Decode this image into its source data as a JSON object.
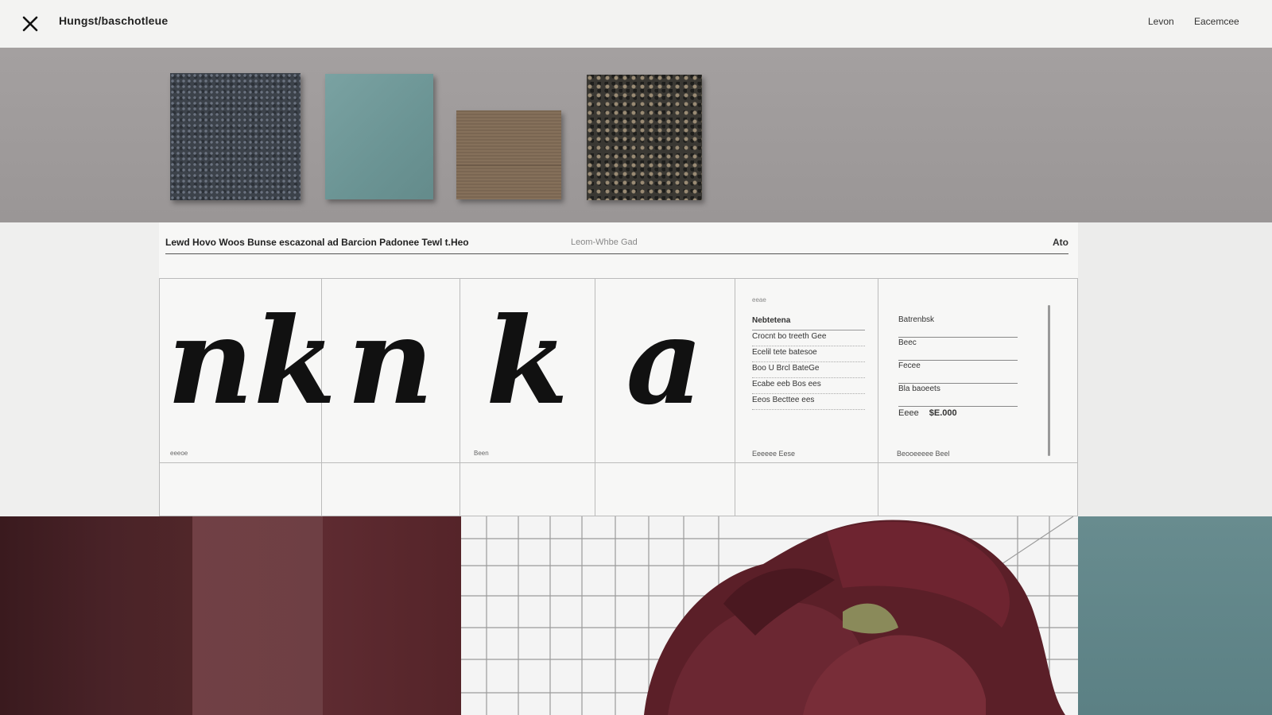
{
  "header": {
    "close_icon": "close-icon",
    "brand": "Hungst/baschotleue",
    "nav": [
      "Levon",
      "Eacemcee"
    ]
  },
  "swatches": {
    "items": [
      {
        "name": "dark-pebble-texture",
        "color": "#3c424a"
      },
      {
        "name": "teal-fabric",
        "color": "#6b9494"
      },
      {
        "name": "brown-linen",
        "color": "#806b56"
      },
      {
        "name": "speckled-granite",
        "color": "#3a3833"
      }
    ]
  },
  "panel": {
    "title": "Lewd Hovo Woos Bunse escazonal ad Barcion Padonee Tewl t.Heo",
    "subtitle": "Leom-Whbe Gad",
    "page_num": "Ato",
    "glyphs": [
      "nk",
      "n",
      "k",
      "a"
    ],
    "captions": [
      "eeeoe",
      "Been"
    ],
    "spec_label": "eeae",
    "spec_rows": [
      "Nebtetena",
      "Crocnt bo treeth Gee",
      "Ecelil tete batesoe",
      "Boo U Brcl BateGe",
      "Ecabe eeb Bos ees",
      "Eeos Becttee ees"
    ],
    "field_rows": [
      "Batrenbsk",
      "Beec",
      "Fecee",
      "Bla baoeets"
    ],
    "price_label": "Eeee",
    "price_value": "$E.000",
    "caption_a": "Eeeeee Eese",
    "caption_b": "Beooeeeee Beel"
  },
  "palette": {
    "colors": [
      "#4a2328",
      "#6e3f44",
      "#5a282e",
      "#6b1f27",
      "#5e8488"
    ]
  }
}
